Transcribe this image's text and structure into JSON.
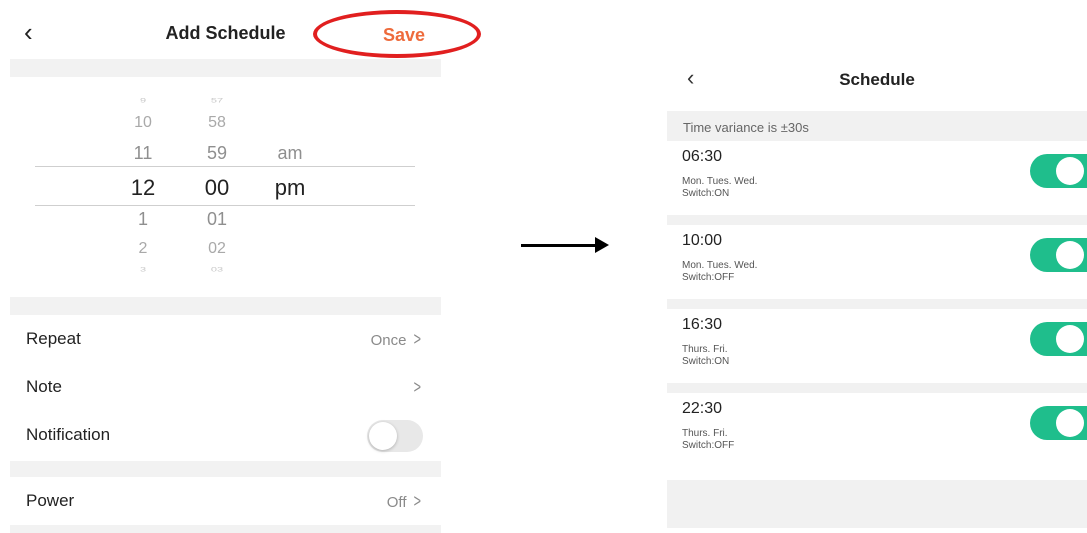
{
  "add_schedule": {
    "back_icon": "chevron-left-icon",
    "title": "Add Schedule",
    "save_label": "Save",
    "highlight_color": "#e11f1f",
    "picker": {
      "hours": [
        "9",
        "10",
        "11",
        "12",
        "1",
        "2",
        "3"
      ],
      "minutes": [
        "57",
        "58",
        "59",
        "00",
        "01",
        "02",
        "03"
      ],
      "ampm": [
        "am",
        "pm"
      ],
      "selected": {
        "hour": "12",
        "minute": "00",
        "ampm": "pm"
      }
    },
    "rows": {
      "repeat": {
        "label": "Repeat",
        "value": "Once"
      },
      "note": {
        "label": "Note",
        "value": ""
      },
      "notification": {
        "label": "Notification",
        "enabled": false
      },
      "power": {
        "label": "Power",
        "value": "Off"
      }
    }
  },
  "arrow_icon": "arrow-right-icon",
  "schedule": {
    "back_icon": "chevron-left-icon",
    "title": "Schedule",
    "variance": "Time variance is  ±30s",
    "accent_color": "#1fbe8c",
    "items": [
      {
        "time": "06:30",
        "days": "Mon. Tues. Wed.",
        "switch": "Switch:ON",
        "enabled": true
      },
      {
        "time": "10:00",
        "days": "Mon. Tues. Wed.",
        "switch": "Switch:OFF",
        "enabled": true
      },
      {
        "time": "16:30",
        "days": "Thurs. Fri.",
        "switch": "Switch:ON",
        "enabled": true
      },
      {
        "time": "22:30",
        "days": "Thurs. Fri.",
        "switch": "Switch:OFF",
        "enabled": true
      }
    ]
  }
}
